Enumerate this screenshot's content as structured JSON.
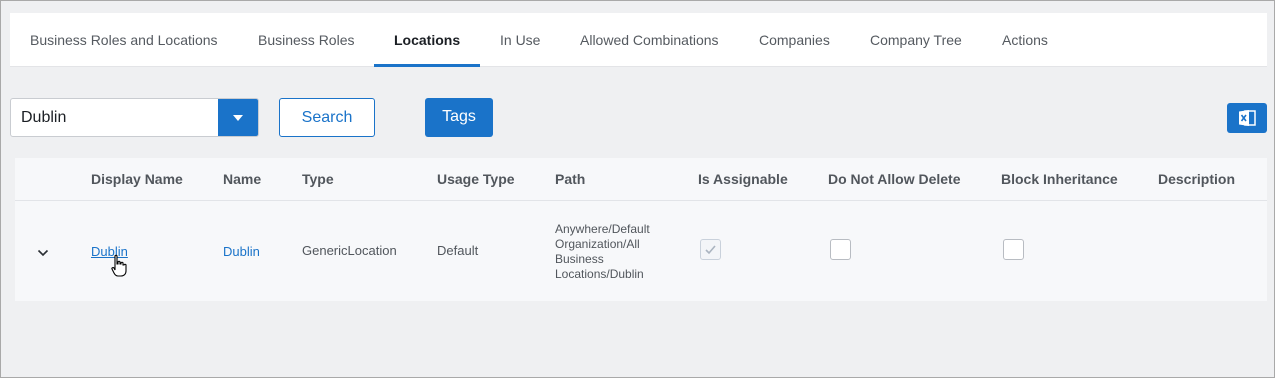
{
  "tabs": [
    {
      "label": "Business Roles and Locations"
    },
    {
      "label": "Business Roles"
    },
    {
      "label": "Locations"
    },
    {
      "label": "In Use"
    },
    {
      "label": "Allowed Combinations"
    },
    {
      "label": "Companies"
    },
    {
      "label": "Company Tree"
    },
    {
      "label": "Actions"
    }
  ],
  "active_tab": "Locations",
  "toolbar": {
    "location_select_value": "Dublin",
    "search_label": "Search",
    "tags_label": "Tags",
    "export_icon": "excel-icon"
  },
  "table": {
    "columns": [
      "Display Name",
      "Name",
      "Type",
      "Usage Type",
      "Path",
      "Is Assignable",
      "Do Not Allow Delete",
      "Block Inheritance",
      "Description"
    ],
    "rows": [
      {
        "display_name": "Dublin",
        "name": "Dublin",
        "type": "GenericLocation",
        "usage_type": "Default",
        "path_lines": [
          "Anywhere/Default",
          "Organization/All",
          "Business",
          "Locations/Dublin"
        ],
        "is_assignable": true,
        "do_not_allow_delete": false,
        "block_inheritance": false,
        "description": ""
      }
    ]
  },
  "colors": {
    "accent": "#1a73c9",
    "page_bg": "#eff0f2"
  }
}
